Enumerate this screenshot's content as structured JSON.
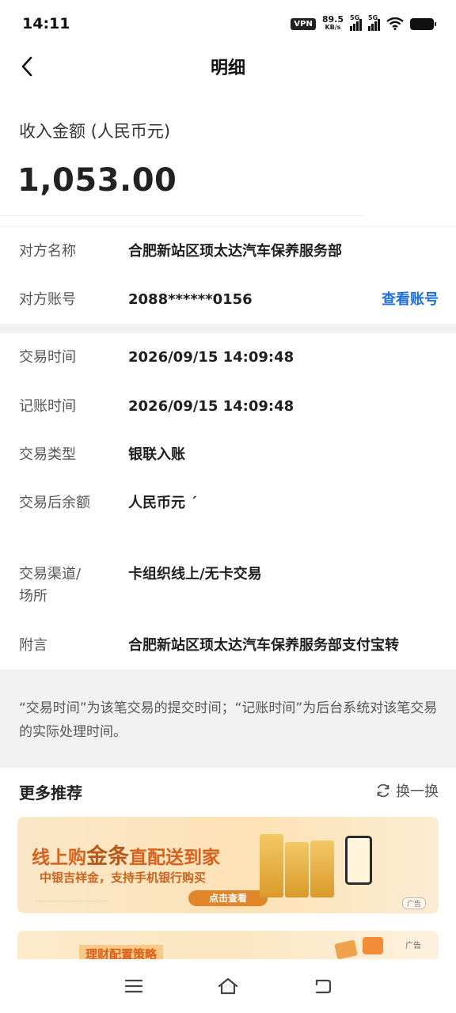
{
  "status_bar": {
    "time": "14:11",
    "vpn": "VPN",
    "speed_value": "89.5",
    "speed_unit": "KB/s",
    "sim1": "5G",
    "sim2": "5G"
  },
  "header": {
    "title": "明细"
  },
  "summary": {
    "amount_label": "收入金额 (人民币元)",
    "amount": "1,053.00"
  },
  "counterparty": {
    "name_label": "对方名称",
    "name_value": "合肥新站区顼太达汽车保养服务部",
    "account_label": "对方账号",
    "account_value": "2088******0156",
    "view_account_link": "查看账号"
  },
  "transaction": {
    "rows": [
      {
        "label": "交易时间",
        "value": "2026/09/15 14:09:48"
      },
      {
        "label": "记账时间",
        "value": "2026/09/15 14:09:48"
      },
      {
        "label": "交易类型",
        "value": "银联入账"
      },
      {
        "label": "交易后余额",
        "value": "人民币元 ´"
      },
      {
        "label": "交易渠道/场所",
        "value": "卡组织线上/无卡交易"
      },
      {
        "label": "附言",
        "value": "合肥新站区顼太达汽车保养服务部支付宝转"
      }
    ]
  },
  "note": "“交易时间”为该笔交易的提交时间；“记账时间”为后台系统对该笔交易的实际处理时间。",
  "recommend": {
    "title": "更多推荐",
    "refresh_label": "换一换",
    "ad1": {
      "line1_prefix": "线上购",
      "line1_big": "金条",
      "line1_suffix": "直配送到家",
      "line2": "中银吉祥金，支持手机银行购买",
      "button": "点击查看",
      "tag": "广告"
    },
    "ad2": {
      "title": "理财配置策略",
      "tag": "广告"
    }
  }
}
